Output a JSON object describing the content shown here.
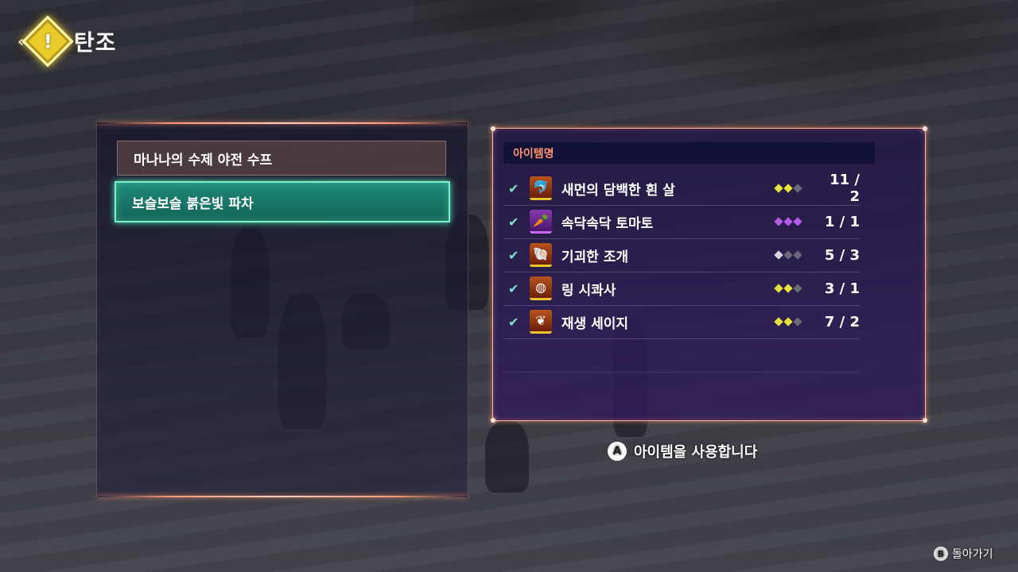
{
  "title": {
    "arrows": "«",
    "icon": "!",
    "text": "탄조"
  },
  "recipes": [
    {
      "label": "마나나의 수제 야전 수프",
      "selected": false
    },
    {
      "label": "보슬보슬 붉은빛 파차",
      "selected": true
    }
  ],
  "items_panel": {
    "header": "아이템명",
    "items": [
      {
        "name": "새먼의 담백한 흰 살",
        "icon": "fish-icon",
        "icon_glyph": "🐬",
        "rarity": 2,
        "rarity_color": "#e8e23a",
        "count": "11 / 2",
        "checked": true
      },
      {
        "name": "속닥속닥 토마토",
        "icon": "vegetable-icon",
        "icon_glyph": "🥕",
        "rarity": 3,
        "rarity_color": "#b45ae8",
        "count": "1 / 1",
        "checked": true
      },
      {
        "name": "기괴한 조개",
        "icon": "shell-icon",
        "icon_glyph": "🐚",
        "rarity": 1,
        "rarity_color": "#d8d8e0",
        "count": "5 / 3",
        "checked": true
      },
      {
        "name": "링 시콰사",
        "icon": "citrus-icon",
        "icon_glyph": "◍",
        "rarity": 2,
        "rarity_color": "#e8e23a",
        "count": "3 / 1",
        "checked": true
      },
      {
        "name": "재생 세이지",
        "icon": "leaf-icon",
        "icon_glyph": "❦",
        "rarity": 2,
        "rarity_color": "#e8e23a",
        "count": "7 / 2",
        "checked": true
      }
    ]
  },
  "hint": {
    "button": "A",
    "text": "아이템을 사용합니다"
  },
  "back": {
    "button": "B",
    "text": "돌아가기"
  }
}
